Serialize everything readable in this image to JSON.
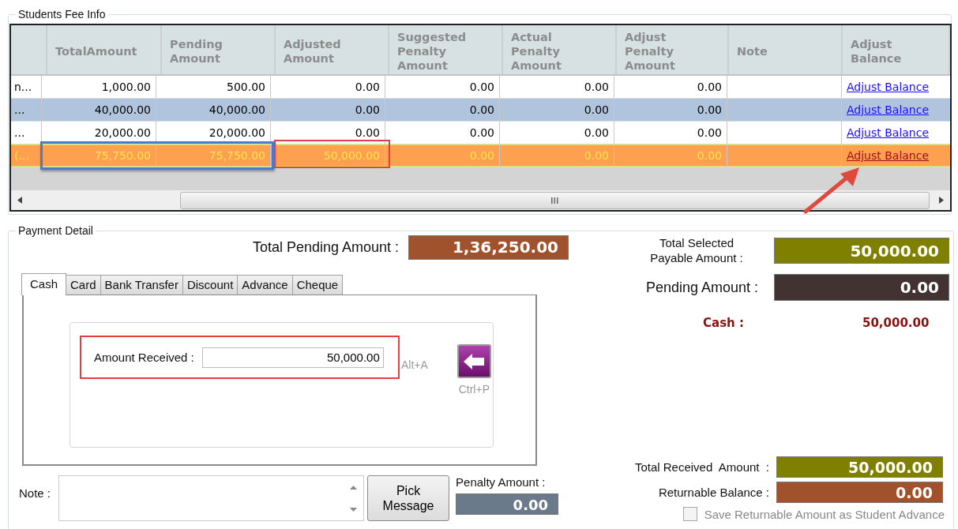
{
  "fee_info": {
    "title": "Students Fee Info",
    "columns": [
      "TotalAmount",
      "Pending Amount",
      "Adjusted Amount",
      "Suggested Penalty Amount",
      "Actual Penalty Amount",
      "Adjust Penalty Amount",
      "Note",
      "Adjust Balance"
    ],
    "rows": [
      {
        "column_1": "n...",
        "amounts": [
          "1,000.00",
          "500.00",
          "0.00",
          "0.00",
          "0.00",
          "0.00"
        ],
        "link": "Adjust Balance",
        "selected": false,
        "highlighted": false
      },
      {
        "column_1": "...",
        "amounts": [
          "40,000.00",
          "40,000.00",
          "0.00",
          "0.00",
          "0.00",
          "0.00"
        ],
        "link": "Adjust Balance",
        "selected": true,
        "highlighted": false
      },
      {
        "column_1": "...",
        "amounts": [
          "20,000.00",
          "20,000.00",
          "0.00",
          "0.00",
          "0.00",
          "0.00"
        ],
        "link": "Adjust Balance",
        "selected": false,
        "highlighted": false
      },
      {
        "column_1": "(...",
        "amounts": [
          "75,750.00",
          "75,750.00",
          "50,000.00",
          "0.00",
          "0.00",
          "0.00"
        ],
        "link": "Adjust Balance",
        "selected": false,
        "highlighted": true
      }
    ]
  },
  "payment": {
    "title": "Payment Detail",
    "total_pending": {
      "label": "Total Pending Amount :",
      "value": "1,36,250.00"
    },
    "tabs": [
      {
        "label": "Cash",
        "selected": true
      },
      {
        "label": "Card",
        "selected": false
      },
      {
        "label": "Bank Transfer",
        "selected": false
      },
      {
        "label": "Discount",
        "selected": false
      },
      {
        "label": "Advance",
        "selected": false
      },
      {
        "label": "Cheque",
        "selected": false
      }
    ],
    "amount_received": {
      "label": "Amount Received :",
      "value": "50,000.00",
      "shortcut": "Alt+A"
    },
    "add_button": {
      "shortcut": "Ctrl+P"
    },
    "note": {
      "label": "Note :"
    },
    "pick_button": "Pick Message",
    "penalty": {
      "label": "Penalty Amount :",
      "value": "0.00"
    },
    "summary": [
      {
        "kind": "payable",
        "label": "Total Selected Payable Amount :",
        "value": "50,000.00"
      },
      {
        "kind": "pending",
        "label": "Pending Amount :",
        "value": "0.00"
      },
      {
        "kind": "cash",
        "label": "Cash :",
        "value": "50,000.00"
      }
    ],
    "totals": [
      {
        "kind": "received",
        "label": "Total Received  Amount  :",
        "value": "50,000.00"
      },
      {
        "kind": "returnable",
        "label": "Returnable Balance :",
        "value": "0.00"
      }
    ],
    "save_advance": {
      "label": "Save Returnable Amount as Student Advance",
      "checked": false
    }
  }
}
